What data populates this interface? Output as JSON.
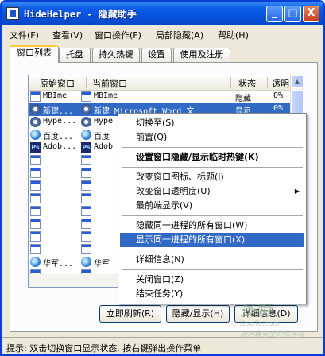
{
  "window": {
    "title": "HideHelper - 隐藏助手",
    "minimize": "_",
    "maximize": "□",
    "close": "X"
  },
  "menubar": [
    "文件(F)",
    "查看(V)",
    "窗口操作(F)",
    "局部隐藏(A)",
    "帮助(H)"
  ],
  "tabs": [
    "窗口列表",
    "托盘",
    "持久热键",
    "设置",
    "使用及注册"
  ],
  "list": {
    "columns": [
      "原始窗口",
      "当前窗口",
      "状态",
      "透明"
    ],
    "rows": [
      {
        "icon": "blank",
        "orig": "MBIme",
        "cur": "MBIme",
        "state": "隐藏",
        "alpha": "0%"
      },
      {
        "icon": "gear",
        "orig": "新建...",
        "cur": "新建 Microsoft Word 文",
        "state": "显示",
        "alpha": "0%"
      },
      {
        "icon": "gear",
        "orig": "Hype...",
        "cur": "Hype",
        "state": "",
        "alpha": ""
      },
      {
        "icon": "ie",
        "orig": "百度...",
        "cur": "百度",
        "state": "",
        "alpha": ""
      },
      {
        "icon": "ps",
        "orig": "Adob...",
        "cur": "Adob",
        "state": "",
        "alpha": ""
      },
      {
        "icon": "blank",
        "orig": "",
        "cur": "",
        "state": "",
        "alpha": ""
      },
      {
        "icon": "blank",
        "orig": "",
        "cur": "",
        "state": "",
        "alpha": ""
      },
      {
        "icon": "blank",
        "orig": "",
        "cur": "",
        "state": "",
        "alpha": ""
      },
      {
        "icon": "blank",
        "orig": "",
        "cur": "",
        "state": "",
        "alpha": ""
      },
      {
        "icon": "blank",
        "orig": "",
        "cur": "",
        "state": "",
        "alpha": ""
      },
      {
        "icon": "blank",
        "orig": "",
        "cur": "",
        "state": "",
        "alpha": ""
      },
      {
        "icon": "blank",
        "orig": "",
        "cur": "",
        "state": "",
        "alpha": ""
      },
      {
        "icon": "blank",
        "orig": "",
        "cur": "",
        "state": "",
        "alpha": ""
      },
      {
        "icon": "ie",
        "orig": "华军...",
        "cur": "华军",
        "state": "",
        "alpha": ""
      },
      {
        "icon": "blank",
        "orig": "",
        "cur": "",
        "state": "",
        "alpha": ""
      }
    ]
  },
  "buttons": [
    "立即刷新(R)",
    "隐藏/显示(H)",
    "详细信息(D)"
  ],
  "statusbar": "提示: 双击切换窗口显示状态, 按右键弹出操作菜单",
  "context_menu": [
    {
      "label": "切换至(S)"
    },
    {
      "label": "前置(Q)"
    },
    {
      "sep": true
    },
    {
      "label": "设置窗口隐藏/显示临时热键(K)",
      "bold": true
    },
    {
      "sep": true
    },
    {
      "label": "改变窗口图标、标题(I)"
    },
    {
      "label": "改变窗口透明度(U)",
      "submenu": true
    },
    {
      "label": "最前端显示(V)"
    },
    {
      "sep": true
    },
    {
      "label": "隐藏同一进程的所有窗口(W)"
    },
    {
      "label": "显示同一进程的所有窗口(X)",
      "highlight": true
    },
    {
      "sep": true
    },
    {
      "label": "详细信息(N)"
    },
    {
      "sep": true
    },
    {
      "label": "关闭窗口(Z)"
    },
    {
      "label": "结束任务(Y)"
    }
  ],
  "watermark": {
    "big": "多特",
    "small": "DuoTe.com",
    "small2": "国内最安全的软件站"
  },
  "colors": {
    "title_blue": "#0a5be8",
    "selection": "#316ac5",
    "face": "#ece9d8"
  }
}
